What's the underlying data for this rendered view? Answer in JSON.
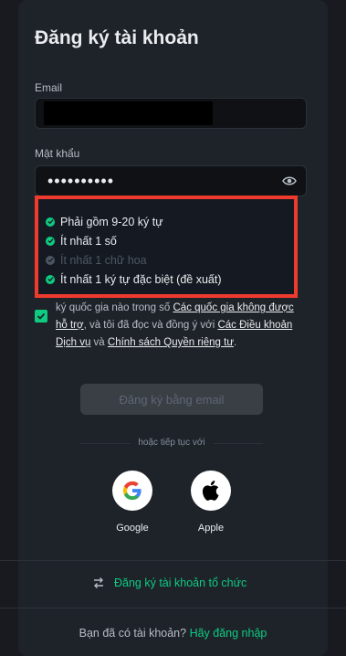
{
  "title": "Đăng ký tài khoản",
  "email": {
    "label": "Email"
  },
  "password": {
    "label": "Mật khẩu",
    "masked_value": "••••••••••"
  },
  "requirements": [
    {
      "text": "Phải gồm 9-20 ký tự",
      "met": true
    },
    {
      "text": "Ít nhất 1 số",
      "met": true
    },
    {
      "text": "Ít nhất 1 chữ hoa",
      "met": false
    },
    {
      "text": "Ít nhất 1 ký tự đặc biệt (đề xuất)",
      "met": true
    }
  ],
  "terms": {
    "text_1": "ký quốc gia nào trong số ",
    "link_1": "Các quốc gia không được hỗ trợ",
    "text_2": ", và tôi đã đọc và đồng ý với ",
    "link_2": "Các Điều khoản Dịch vụ",
    "text_3": " và ",
    "link_3": "Chính sách Quyền riêng tư",
    "text_4": "."
  },
  "buttons": {
    "email_signup": "Đăng ký bằng email"
  },
  "divider": "hoặc tiếp tục với",
  "social": {
    "google": "Google",
    "apple": "Apple"
  },
  "org_signup": "Đăng ký tài khoản tổ chức",
  "footer": {
    "question": "Bạn đã có tài khoản? ",
    "login": "Hãy đăng nhập"
  },
  "colors": {
    "accent_green": "#0ecb81",
    "highlight_red": "#ef3b2d",
    "background": "#181a20"
  }
}
